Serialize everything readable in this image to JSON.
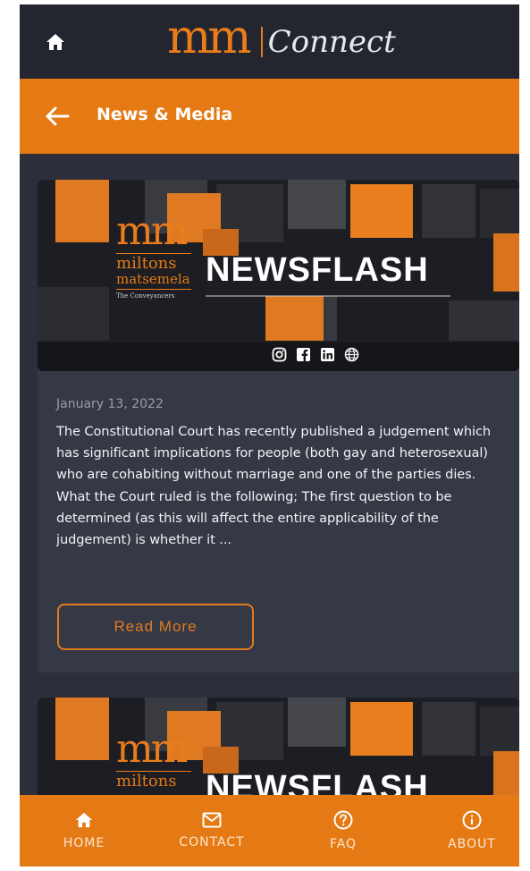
{
  "header": {
    "logo_mark": "mm",
    "logo_text": "Connect"
  },
  "subheader": {
    "title": "News & Media"
  },
  "articles": [
    {
      "banner": {
        "brand_mark": "mm",
        "brand_line1": "miltons",
        "brand_line2": "matsemela",
        "brand_tagline": "The Conveyancers",
        "headline": "NEWSFLASH",
        "social_icons": [
          "instagram-icon",
          "facebook-icon",
          "linkedin-icon",
          "globe-icon"
        ]
      },
      "date": "January 13, 2022",
      "excerpt": "The Constitutional Court has recently published a judgement which has significant implications for people (both gay and heterosexual) who are cohabiting without marriage and one of the parties dies. What the Court ruled is the following; The first question to be determined (as this will affect the entire applicability of the judgement) is whether it ...",
      "read_more_label": "Read More"
    },
    {
      "banner": {
        "brand_mark": "mm",
        "brand_line1": "miltons",
        "headline": "NEWSFLASH"
      }
    }
  ],
  "bottom_nav": [
    {
      "label": "HOME",
      "icon": "home-icon"
    },
    {
      "label": "CONTACT",
      "icon": "mail-icon"
    },
    {
      "label": "FAQ",
      "icon": "help-icon"
    },
    {
      "label": "ABOUT",
      "icon": "info-icon"
    }
  ],
  "colors": {
    "accent": "#e57a14",
    "header_bg": "#23262f",
    "page_bg": "#2c2f3b",
    "card_bg": "#353845"
  }
}
